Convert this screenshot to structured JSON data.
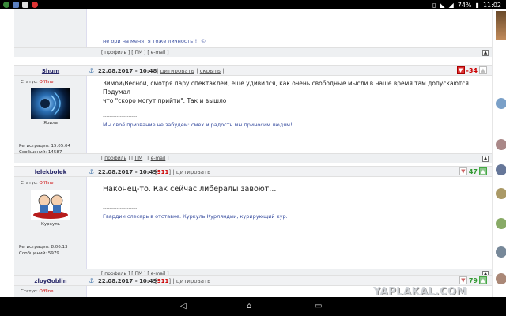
{
  "statusbar": {
    "battery": "74%",
    "time": "11:02"
  },
  "post0": {
    "separator": "--------------------",
    "signature": "не ори на меня! я тоже личность!!! ©",
    "footer": {
      "profile": "профиль",
      "pm": "ПМ",
      "email": "e-mail"
    }
  },
  "post1": {
    "nick": "Shum",
    "date": "22.08.2017 - 10:48",
    "quote": "цитировать",
    "hide": "скрыть",
    "rating": "-34",
    "status_label": "Статус:",
    "status": "Offline",
    "avatar_name": "Ярила",
    "reg": "Регистрация: 15.05.04",
    "msgs": "Сообщений: 14587",
    "text1": "Зимой\\Весной, смотря пару спектаклей, еще удивился, как очень свободные мысли в наше время там допускаются. Подумал",
    "text2": "что \"скоро могут прийти\". Так и вышло",
    "separator": "--------------------",
    "signature": "Мы своё призвание не забудем: смех и радость мы приносим людям!",
    "footer": {
      "profile": "профиль",
      "pm": "ПМ",
      "email": "e-mail"
    }
  },
  "post2": {
    "nick": "lelekbolek",
    "date": "22.08.2017 - 10:49",
    "num": "911",
    "quote": "цитировать",
    "rating": "47",
    "status_label": "Статус:",
    "status": "Offline",
    "avatar_name": "Куркуль",
    "reg": "Регистрация: 8.06.13",
    "msgs": "Сообщений: 5979",
    "text": "Наконец-то. Как сейчас либералы завоют...",
    "separator": "--------------------",
    "signature": "Гвардии слесарь в отставке. Куркуль Курляндии, курирующий кур.",
    "footer": {
      "profile": "профиль",
      "pm": "ПМ",
      "email": "e-mail"
    }
  },
  "post3": {
    "nick": "zloyGoblin",
    "date": "22.08.2017 - 10:49",
    "num": "911",
    "quote": "цитировать",
    "rating": "79",
    "status_label": "Статус:",
    "status": "Offline"
  },
  "watermark": "YAPLAKAL.COM",
  "colors": {
    "accent": "#3a4fa0",
    "negative": "#cc0000",
    "positive": "#339933"
  }
}
